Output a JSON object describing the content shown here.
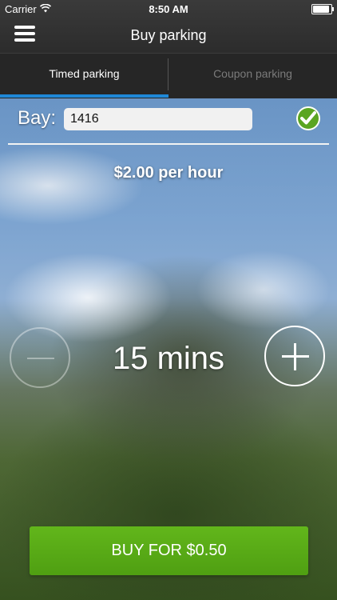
{
  "status_bar": {
    "carrier": "Carrier",
    "time": "8:50 AM"
  },
  "nav": {
    "title": "Buy parking"
  },
  "tabs": [
    {
      "label": "Timed parking",
      "active": true
    },
    {
      "label": "Coupon parking",
      "active": false
    }
  ],
  "bay": {
    "label": "Bay:",
    "value": "1416"
  },
  "rate": "$2.00 per hour",
  "duration": "15 mins",
  "buy_button": "BUY FOR $0.50",
  "colors": {
    "accent": "#1e88d8",
    "buy": "#58ac16",
    "check": "#5aa521"
  },
  "icons": [
    "menu-icon",
    "wifi-icon",
    "battery-icon",
    "checkmark-icon",
    "minus-icon",
    "plus-icon"
  ]
}
